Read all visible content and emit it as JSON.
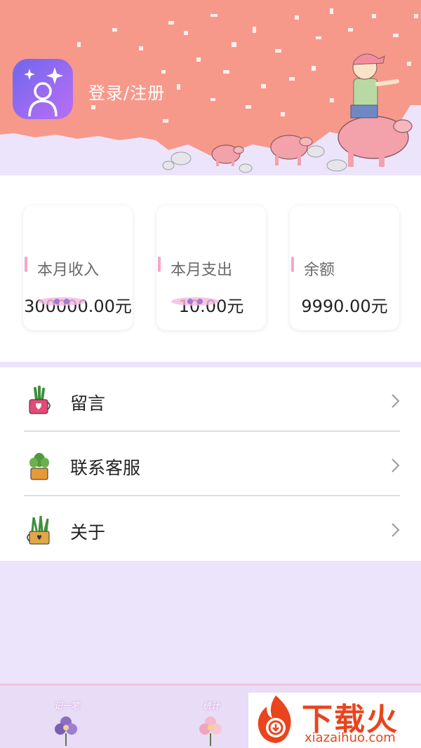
{
  "header": {
    "login_label": "登录/注册"
  },
  "stats": [
    {
      "label": "本月收入",
      "value": "300000.00元"
    },
    {
      "label": "本月支出",
      "value": "10.00元"
    },
    {
      "label": "余额",
      "value": "9990.00元"
    }
  ],
  "menu": [
    {
      "label": "留言",
      "icon": "plant-pot-heart-icon"
    },
    {
      "label": "联系客服",
      "icon": "succulent-pot-icon"
    },
    {
      "label": "关于",
      "icon": "plant-basket-icon"
    }
  ],
  "bottom_nav": {
    "tabs": [
      {
        "label": "记一笔",
        "icon": "flower-icon"
      },
      {
        "label": "统计",
        "icon": "flower-icon"
      }
    ]
  },
  "watermark": {
    "brand": "下载火",
    "url": "xiazaihuo.com"
  },
  "colors": {
    "header_salmon": "#f6998b",
    "background_lavender": "#ece4fb",
    "accent_pink": "#f6a6c8",
    "watermark_orange": "#e9441e"
  }
}
